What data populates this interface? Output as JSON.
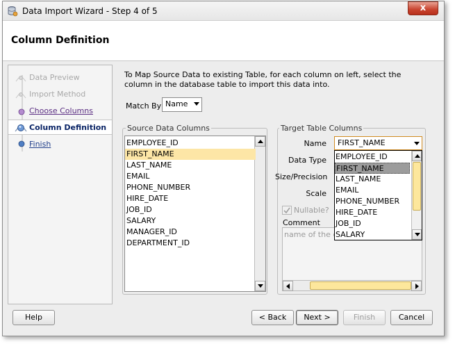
{
  "window": {
    "title": "Data Import Wizard - Step 4 of 5",
    "close_glyph": "x"
  },
  "header": {
    "title": "Column Definition"
  },
  "steps": [
    {
      "label": "Data Preview",
      "state": "disabled"
    },
    {
      "label": "Import Method",
      "state": "disabled"
    },
    {
      "label": "Choose Columns",
      "state": "visited"
    },
    {
      "label": "Column Definition",
      "state": "current"
    },
    {
      "label": "Finish",
      "state": "link"
    }
  ],
  "instructions": "To Map Source Data to existing Table, for each column on left, select the column in the database table to import this data into.",
  "match_by": {
    "label": "Match By",
    "value": "Name"
  },
  "source_group": {
    "title": "Source Data Columns",
    "items": [
      "EMPLOYEE_ID",
      "FIRST_NAME",
      "LAST_NAME",
      "EMAIL",
      "PHONE_NUMBER",
      "HIRE_DATE",
      "JOB_ID",
      "SALARY",
      "MANAGER_ID",
      "DEPARTMENT_ID"
    ],
    "selected": "FIRST_NAME"
  },
  "target_group": {
    "title": "Target Table Columns",
    "name_label": "Name",
    "name_value": "FIRST_NAME",
    "data_type_label": "Data Type",
    "size_label": "Size/Precision",
    "scale_label": "Scale",
    "nullable_label": "Nullable?",
    "comment_label": "Comment",
    "comment_text": "name of the em",
    "dropdown_items": [
      "EMPLOYEE_ID",
      "FIRST_NAME",
      "LAST_NAME",
      "EMAIL",
      "PHONE_NUMBER",
      "HIRE_DATE",
      "JOB_ID",
      "SALARY"
    ],
    "dropdown_selected": "FIRST_NAME"
  },
  "buttons": {
    "help": "Help",
    "back": "< Back",
    "next": "Next >",
    "finish": "Finish",
    "cancel": "Cancel"
  },
  "colors": {
    "selection_highlight": "#fde6a6",
    "dropdown_selection": "#9c9c9c",
    "current_step_text": "#0a2466",
    "visited_link": "#5a2d82",
    "close_button": "#c8432e"
  }
}
